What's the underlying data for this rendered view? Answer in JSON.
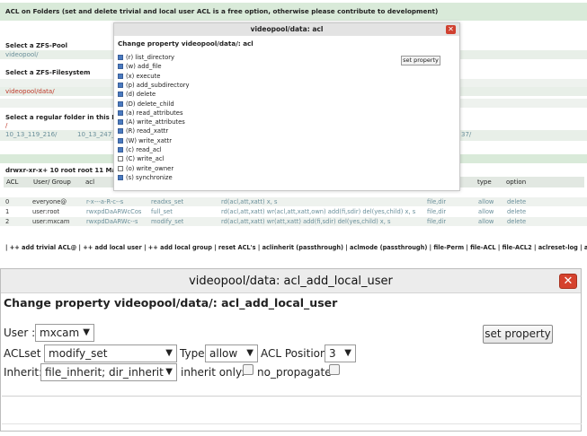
{
  "background": {
    "banner": "ACL on Folders (set and delete trivial and local user ACL is a free option, otherwise please contribute to development)",
    "pool_label": "Select a ZFS-Pool",
    "pool_value": "videopool/",
    "fs_label": "Select a ZFS-Filesystem",
    "fs_value": "videopool/data/",
    "folder_label": "Select a regular folder in this Filesys",
    "folder_slash": "/",
    "folders": [
      "10_13_119_216/",
      "10_13_247_",
      "37/"
    ],
    "stat_line": "drwxr-xr-x+ 10 root root 11 May 4 1(",
    "table_headers": [
      "ACL",
      "User/ Group",
      "acl",
      "type",
      "option"
    ],
    "rows": [
      {
        "acl": "0",
        "user": "everyone@",
        "perm": "r-x---a-R-c--s",
        "set": "readxs_set",
        "detail": "rd(acl,att,xatt) x, s",
        "inherit": "file,dir",
        "type": "allow",
        "option": "delete"
      },
      {
        "acl": "1",
        "user": "user:root",
        "perm": "rwxpdDaARWcCos",
        "set": "full_set",
        "detail": "rd(acl,att,xatt) wr(acl,att,xatt,own) add(fi,sdir) del(yes,child) x, s",
        "inherit": "file,dir",
        "type": "allow",
        "option": "delete"
      },
      {
        "acl": "2",
        "user": "user:mxcam",
        "perm": "rwxpdDaARWc--s",
        "set": "modify_set",
        "detail": "rd(acl,att,xatt) wr(att,xatt) add(fi,sdir) del(yes,child) x, s",
        "inherit": "file,dir",
        "type": "allow",
        "option": "delete"
      }
    ],
    "nav": "| ++ add trivial ACL@ | ++ add local user | ++ add local group | reset ACL's | aclinherit (passthrough) | aclmode (passthrough) | file-Perm | file-ACL | file-ACL2 | aclreset-log | aclreset20-log |"
  },
  "small_dialog": {
    "title": "videopool/data: acl",
    "heading": "Change property videopool/data/: acl",
    "button": "set property",
    "permissions": [
      {
        "label": "(r) list_directory",
        "checked": true
      },
      {
        "label": "(w) add_file",
        "checked": true
      },
      {
        "label": "(x) execute",
        "checked": true
      },
      {
        "label": "(p) add_subdirectory",
        "checked": true
      },
      {
        "label": "(d) delete",
        "checked": true
      },
      {
        "label": "(D) delete_child",
        "checked": true
      },
      {
        "label": "(a) read_attributes",
        "checked": true
      },
      {
        "label": "(A) write_attributes",
        "checked": true
      },
      {
        "label": "(R) read_xattr",
        "checked": true
      },
      {
        "label": "(W) write_xattr",
        "checked": true
      },
      {
        "label": "(c) read_acl",
        "checked": true
      },
      {
        "label": "(C) write_acl",
        "checked": false
      },
      {
        "label": "(o) write_owner",
        "checked": false
      },
      {
        "label": "(s) synchronize",
        "checked": true
      }
    ]
  },
  "dialog": {
    "title": "videopool/data: acl_add_local_user",
    "heading": "Change property videopool/data/: acl_add_local_user",
    "user_label": "User :",
    "user_value": "mxcam",
    "set_property": "set property",
    "aclset_label": "ACLset :",
    "aclset_value": "modify_set",
    "type_label": "Type",
    "type_value": "allow",
    "position_label": "ACL Position",
    "position_value": "3",
    "inherit_label": "Inherit:",
    "inherit_value": "file_inherit; dir_inherit",
    "inherit_only_label": "inherit only:",
    "no_propagate_label": "no_propagate"
  },
  "icons": {
    "close": "close-icon",
    "dropdown": "chevron-down-icon"
  },
  "colors": {
    "close_red": "#d5422e",
    "banner_green": "#d9ead9",
    "link_teal": "#6a8f9a",
    "fs_red": "#c0392b"
  }
}
